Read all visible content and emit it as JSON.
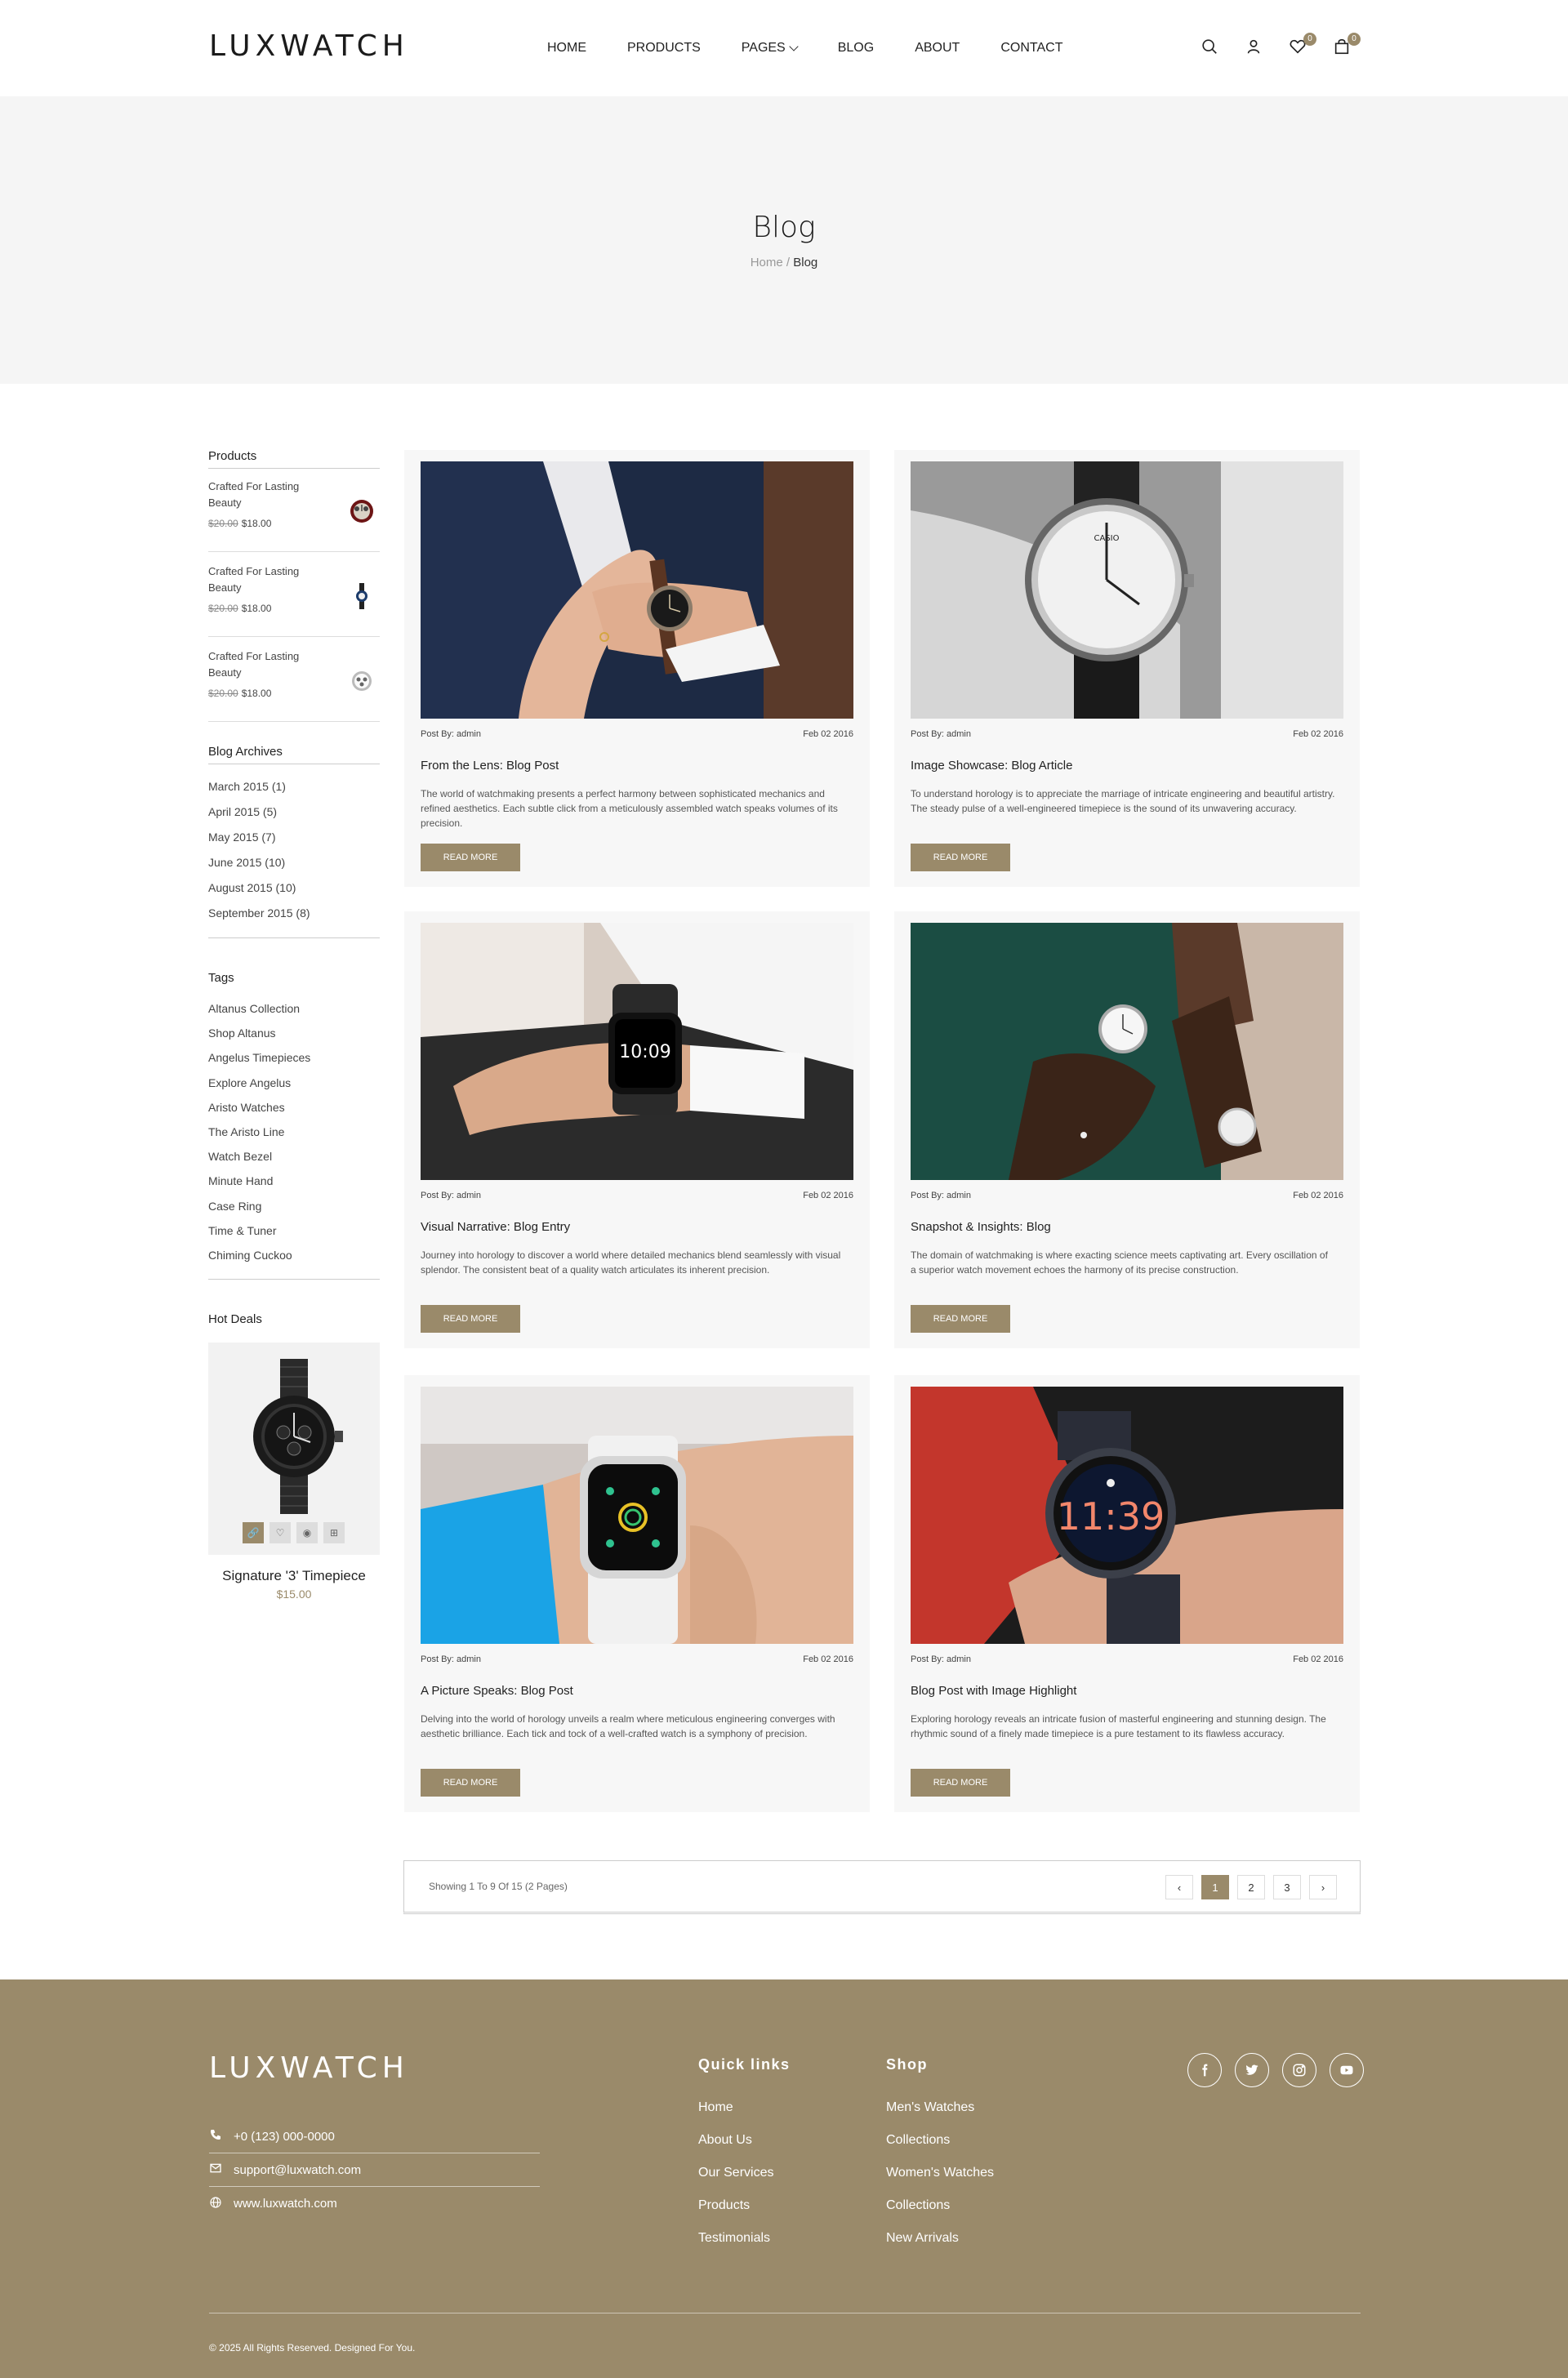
{
  "header": {
    "logo": "LUXWATCH",
    "nav": [
      "HOME",
      "PRODUCTS",
      "PAGES",
      "BLOG",
      "ABOUT",
      "CONTACT"
    ],
    "wishlist_count": "0",
    "cart_count": "0"
  },
  "hero": {
    "title": "Blog",
    "crumb_home": "Home",
    "crumb_sep": "/",
    "crumb_current": "Blog"
  },
  "sidebar": {
    "products_title": "Products",
    "products": [
      {
        "name": "Crafted For Lasting Beauty",
        "old_price": "$20.00",
        "price": "$18.00"
      },
      {
        "name": "Crafted For Lasting Beauty",
        "old_price": "$20.00",
        "price": "$18.00"
      },
      {
        "name": "Crafted For Lasting Beauty",
        "old_price": "$20.00",
        "price": "$18.00"
      }
    ],
    "archives_title": "Blog Archives",
    "archives": [
      "March 2015 (1)",
      "April 2015 (5)",
      "May 2015 (7)",
      "June 2015 (10)",
      "August 2015 (10)",
      "September 2015 (8)"
    ],
    "tags_title": "Tags",
    "tags": [
      "Altanus Collection",
      "Shop Altanus",
      "Angelus Timepieces",
      "Explore Angelus",
      "Aristo Watches",
      "The Aristo Line",
      "Watch Bezel",
      "Minute Hand",
      "Case Ring",
      "Time & Tuner",
      "Chiming Cuckoo"
    ],
    "hotdeals_title": "Hot Deals",
    "hotdeal_name": "Signature '3' Timepiece",
    "hotdeal_price": "$15.00"
  },
  "posts": [
    {
      "author": "Post By: admin",
      "date": "Feb 02 2016",
      "title": "From the Lens: Blog Post",
      "excerpt": "The world of watchmaking presents a perfect harmony between sophisticated mechanics and refined aesthetics. Each subtle click from a meticulously assembled watch speaks volumes of its precision.",
      "button": "READ MORE"
    },
    {
      "author": "Post By: admin",
      "date": "Feb 02 2016",
      "title": "Image Showcase: Blog Article",
      "excerpt": "To understand horology is to appreciate the marriage of intricate engineering and beautiful artistry. The steady pulse of a well-engineered timepiece is the sound of its unwavering accuracy.",
      "button": "READ MORE"
    },
    {
      "author": "Post By: admin",
      "date": "Feb 02 2016",
      "title": "Visual Narrative: Blog Entry",
      "excerpt": "Journey into horology to discover a world where detailed mechanics blend seamlessly with visual splendor. The consistent beat of a quality watch articulates its inherent precision.",
      "button": "READ MORE"
    },
    {
      "author": "Post By: admin",
      "date": "Feb 02 2016",
      "title": "Snapshot & Insights: Blog",
      "excerpt": "The domain of watchmaking is where exacting science meets captivating art. Every oscillation of a superior watch movement echoes the harmony of its precise construction.",
      "button": "READ MORE"
    },
    {
      "author": "Post By: admin",
      "date": "Feb 02 2016",
      "title": "A Picture Speaks: Blog Post",
      "excerpt": "Delving into the world of horology unveils a realm where meticulous engineering converges with aesthetic brilliance. Each tick and tock of a well-crafted watch is a symphony of precision.",
      "button": "READ MORE"
    },
    {
      "author": "Post By: admin",
      "date": "Feb 02 2016",
      "title": "Blog Post with Image Highlight",
      "excerpt": "Exploring horology reveals an intricate fusion of masterful engineering and stunning design. The rhythmic sound of a finely made timepiece is a pure testament to its flawless accuracy.",
      "button": "READ MORE"
    }
  ],
  "images": {
    "watch1_time": "",
    "smart_time": "10:09",
    "round_time": "11:39",
    "casio_brand": "CASIO"
  },
  "pagination": {
    "info": "Showing 1 To 9 Of 15 (2 Pages)",
    "pages": [
      "1",
      "2",
      "3"
    ],
    "prev": "‹",
    "next": "›"
  },
  "footer": {
    "logo": "LUXWATCH",
    "phone": "+0 (123) 000-0000",
    "email": "support@luxwatch.com",
    "web": "www.luxwatch.com",
    "quick_title": "Quick links",
    "quick": [
      "Home",
      "About Us",
      "Our Services",
      "Products",
      "Testimonials"
    ],
    "shop_title": "Shop",
    "shop": [
      "Men's Watches",
      "Collections",
      "Women's Watches",
      "Collections",
      "New Arrivals"
    ],
    "copyright": "© 2025 All Rights Reserved. Designed For You."
  },
  "colors": {
    "accent": "#9a8a6a",
    "hero_bg": "#f5f5f5",
    "card_bg": "#f7f7f7"
  }
}
